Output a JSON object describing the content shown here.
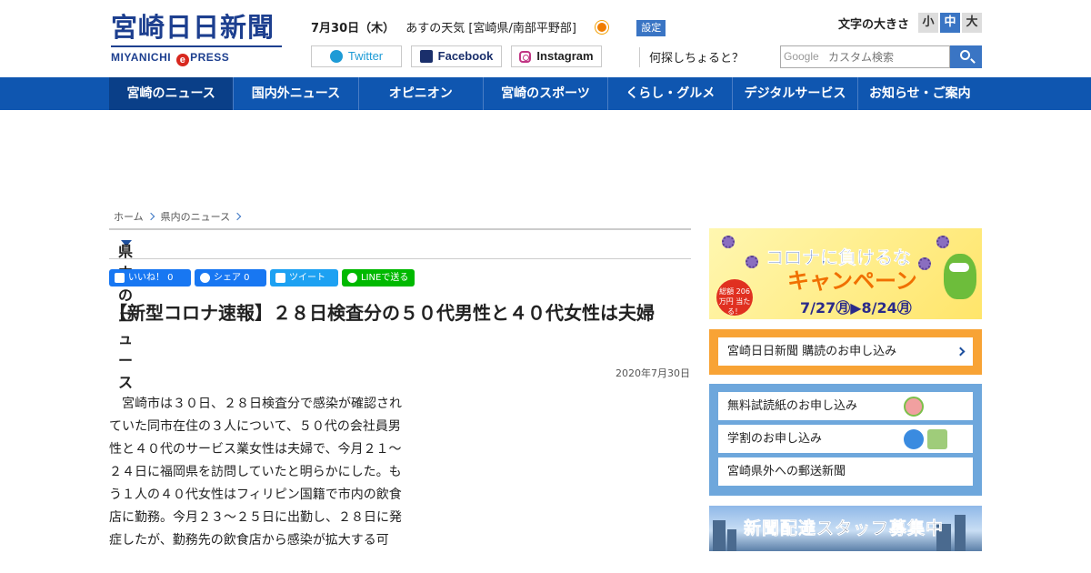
{
  "header": {
    "logo_main": "宮崎日日新聞",
    "logo_sub_left": "MIYANICHI",
    "logo_sub_e": "e",
    "logo_sub_right": "PRESS",
    "date": "7月30日（木）",
    "weather_text": "あすの天気 [宮崎県/南部平野部]",
    "weather_icon": "sun-icon",
    "settings_label": "設定",
    "fontsize_label": "文字の大きさ",
    "fontsize_small": "小",
    "fontsize_medium": "中",
    "fontsize_large": "大",
    "twitter_label": "Twitter",
    "facebook_label": "Facebook",
    "instagram_label": "Instagram",
    "question": "何探しちょると？",
    "search_brand": "Google",
    "search_placeholder": "カスタム検索"
  },
  "nav": {
    "items": [
      {
        "label": "宮崎のニュース"
      },
      {
        "label": "国内外ニュース"
      },
      {
        "label": "オピニオン"
      },
      {
        "label": "宮崎のスポーツ"
      },
      {
        "label": "くらし・グルメ"
      },
      {
        "label": "デジタルサービス"
      },
      {
        "label": "お知らせ・ご案内"
      }
    ]
  },
  "breadcrumb": {
    "home": "ホーム",
    "section": "県内のニュース"
  },
  "section_title": "県内のニュース",
  "share": {
    "like": "いいね！ 0",
    "fb_share": "シェア 0",
    "tweet": "ツイート",
    "line": "LINEで送る"
  },
  "article": {
    "title": "【新型コロナ速報】２８日検査分の５０代男性と４０代女性は夫婦",
    "date": "2020年7月30日",
    "body": "宮崎市は３０日、２８日検査分で感染が確認されていた同市在住の３人について、５０代の会社員男性と４０代のサービス業女性は夫婦で、今月２１～２４日に福岡県を訪問していたと明らかにした。もう１人の４０代女性はフィリピン国籍で市内の飲食店に勤務。今月２３～２５日に出勤し、２８日に発症したが、勤務先の飲食店から感染が拡大する可"
  },
  "sidebar": {
    "corona_banner": {
      "line1": "コロナに負けるな",
      "line2": "キャンペーン",
      "dates": "7/27㊊▶8/24㊊",
      "badge": "総額 206万円 当たる！"
    },
    "subscribe": "宮崎日日新聞 購読のお申し込み",
    "links": [
      {
        "label": "無料試読紙のお申し込み"
      },
      {
        "label": "学割のお申し込み"
      },
      {
        "label": "宮崎県外への郵送新聞"
      }
    ],
    "staff_banner": "新聞配達スタッフ募集中"
  },
  "colors": {
    "nav": "#0f56b0",
    "brand": "#1d3f8f",
    "accent_orange": "#f8a335",
    "accent_blue": "#6ea7dc"
  }
}
